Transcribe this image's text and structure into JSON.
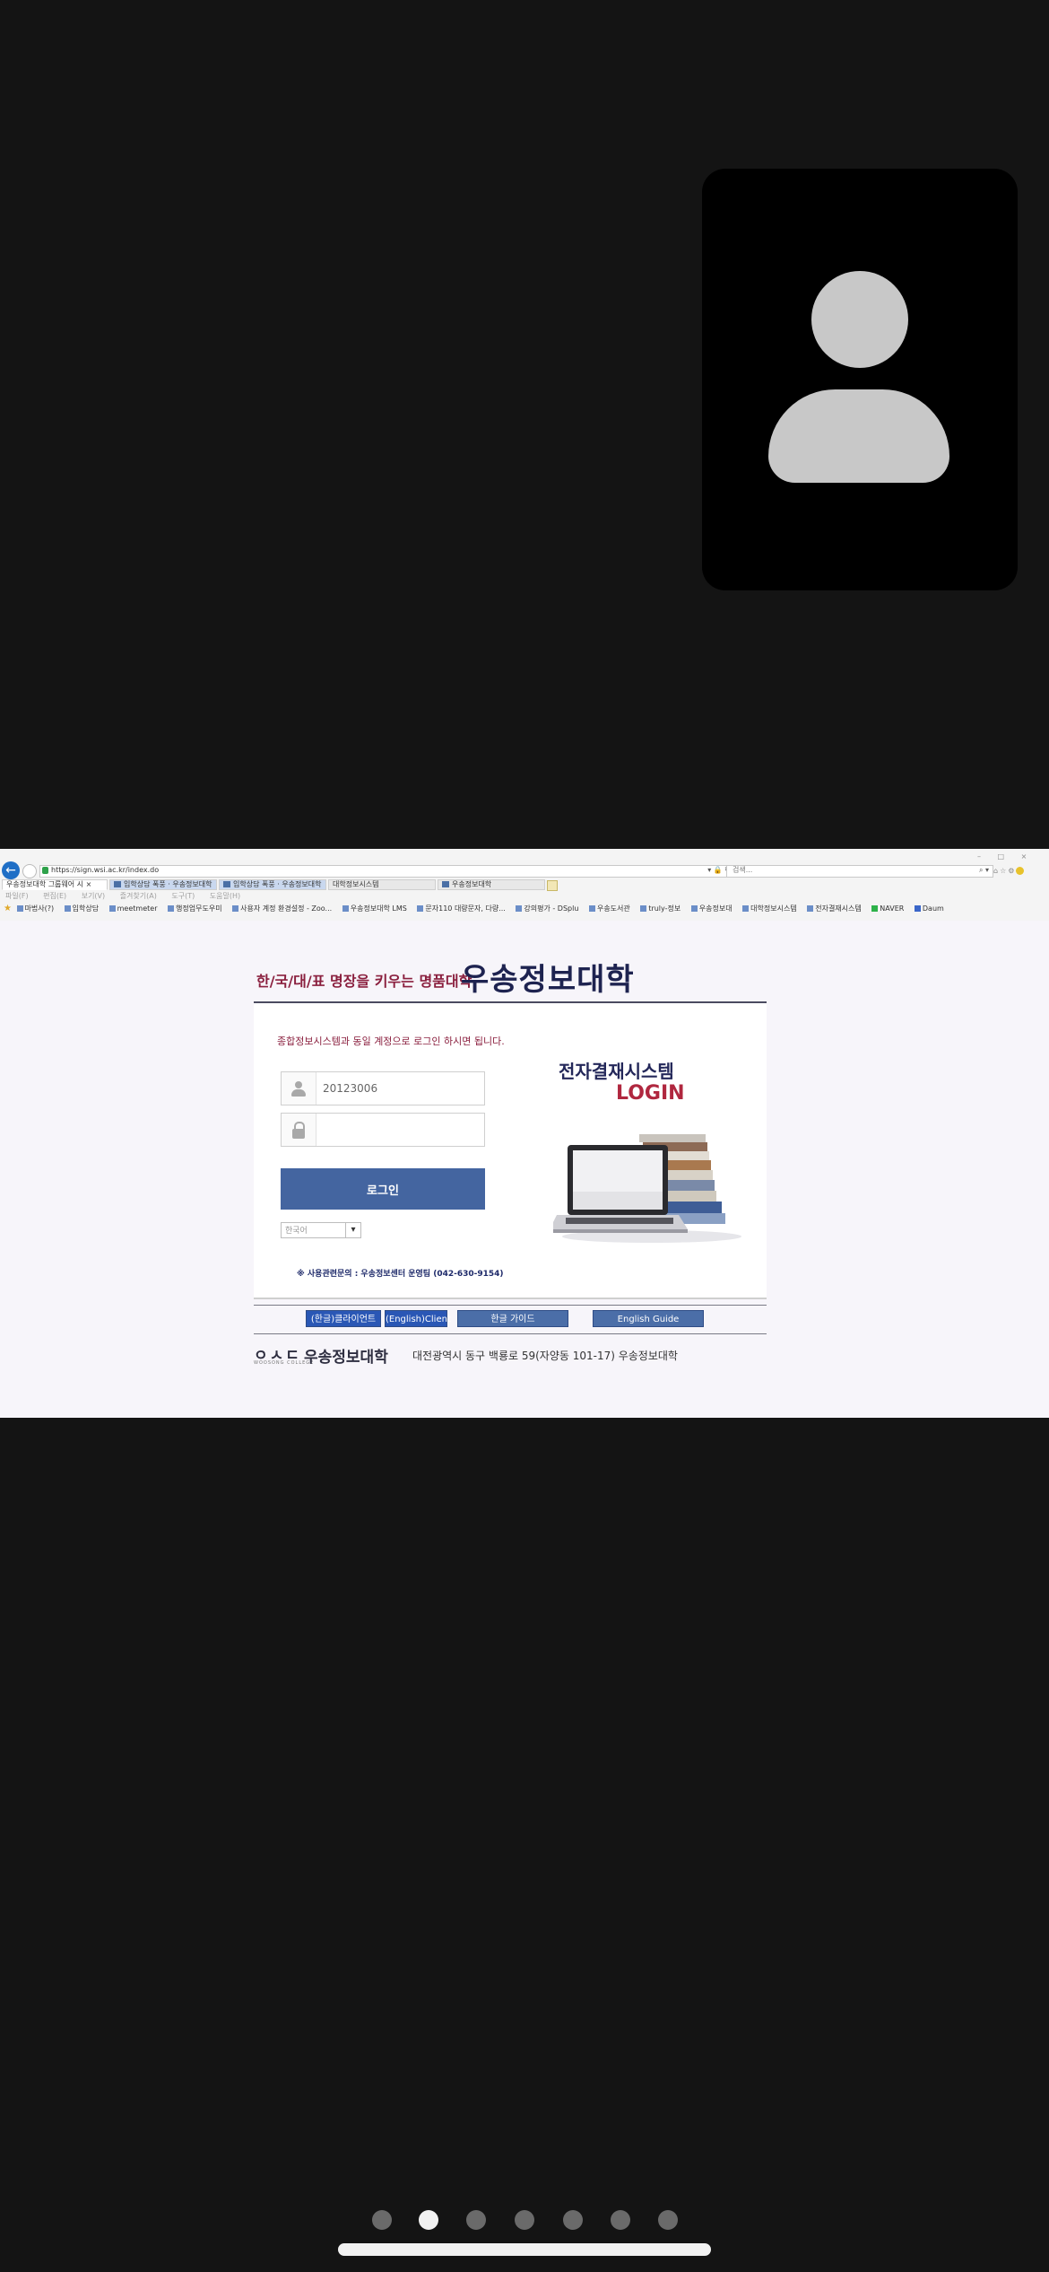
{
  "browser": {
    "address": "https://sign.wsi.ac.kr/index.do",
    "search_placeholder": "검색...",
    "window_controls": "– □ ×",
    "tabs": [
      {
        "label": "우송정보대학 그룹웨어 시",
        "type": "active"
      },
      {
        "label": "입학상담 폭풍 · 우송정보대학",
        "type": "highlight"
      },
      {
        "label": "입학상담 폭풍 · 우송정보대학",
        "type": "highlight"
      },
      {
        "label": "대학정보시스템",
        "type": "normal"
      },
      {
        "label": "우송정보대학",
        "type": "normal"
      }
    ],
    "menu": [
      "파일(F)",
      "편집(E)",
      "보기(V)",
      "즐겨찾기(A)",
      "도구(T)",
      "도움말(H)"
    ],
    "favorites": [
      "마법사(?)",
      "입학상담",
      "meetmeter",
      "행정업무도우미",
      "사용자 계정 환경설정 - Zoo...",
      "우송정보대학 LMS",
      "문자110 대량문자, 다량...",
      "강의평가 - DSplu",
      "우송도서관",
      "truly-정보",
      "우송정보대",
      "대학정보시스템",
      "전자결재시스템",
      "NAVER",
      "Daum"
    ]
  },
  "page": {
    "slogan": "한/국/대/표 명장을 키우는 명품대학",
    "school_title": "우송정보대학",
    "notice": "종합정보시스템과 동일 계정으로 로그인 하시면 됩니다.",
    "username_value": "20123006",
    "password_value": "",
    "login_button": "로그인",
    "language_selected": "한국어",
    "contact": "※ 사용관련문의 : 우송정보센터 운영팀 (042-630-9154)",
    "system_title": "전자결재시스템",
    "system_login": "LOGIN",
    "guide_buttons": {
      "client_ko": "(한글)클라이언트",
      "client_en": "(English)Client",
      "guide_ko": "한글 가이드",
      "guide_en": "English Guide"
    },
    "footer": {
      "logo_mark": "ㅇㅅㄷ",
      "logo_sub": "WOOSONG COLLEGE",
      "name": "우송정보대학",
      "address": "대전광역시 동구 백룡로 59(자양동 101-17) 우송정보대학"
    }
  },
  "pager": {
    "count": 7,
    "active_index": 1
  },
  "colors": {
    "background": "#141414",
    "login_button": "#4465a0",
    "accent_red": "#b0273f",
    "title_navy": "#1e2350"
  }
}
